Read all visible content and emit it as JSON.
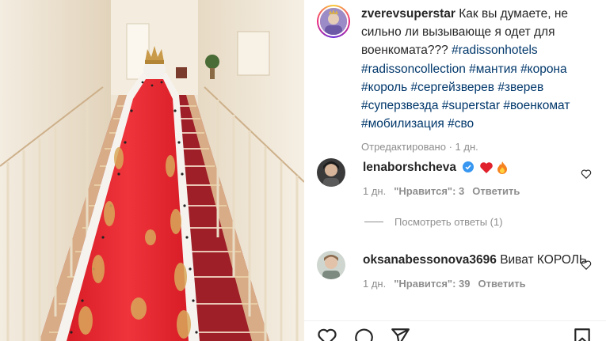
{
  "post": {
    "author": "zverevsuperstar",
    "caption_text": "Как вы думаете, не сильно ли вызывающе я одет для военкомата???",
    "hashtags": [
      "#radissonhotels",
      "#radissoncollection",
      "#мантия",
      "#корона",
      "#король",
      "#сергейзверев",
      "#зверев",
      "#суперзвезда",
      "#superstar",
      "#военкомат",
      "#мобилизация",
      "#сво"
    ],
    "edited_label": "Отредактировано",
    "edited_time": "1 дн."
  },
  "comments": [
    {
      "username": "lenaborshcheva",
      "verified": true,
      "text": "",
      "emojis": [
        "red-heart",
        "fire"
      ],
      "time": "1 дн.",
      "likes_label": "\"Нравится\": 3",
      "reply_label": "Ответить"
    },
    {
      "username": "oksanabessonova3696",
      "verified": false,
      "text": "Виват КОРОЛЬ",
      "emojis": [],
      "time": "1 дн.",
      "likes_label": "\"Нравится\": 39",
      "reply_label": "Ответить"
    }
  ],
  "view_replies_label": "Посмотреть ответы (1)",
  "actions": [
    "like-icon",
    "comment-icon",
    "share-icon",
    "save-icon"
  ],
  "colors": {
    "hashtag": "#00376b",
    "meta": "#8e8e8e",
    "verified": "#3897f0",
    "heart": "#ed4956",
    "robe": "#e8262f",
    "carpet": "#b0242c"
  }
}
